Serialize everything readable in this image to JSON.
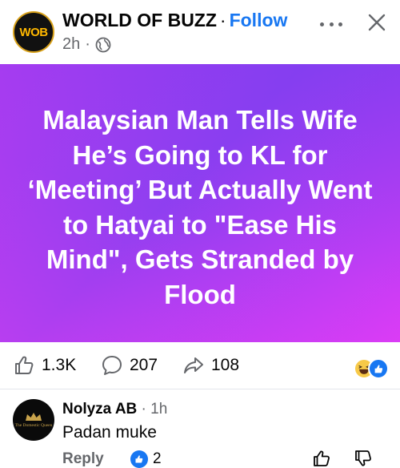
{
  "post": {
    "page_name": "WORLD OF BUZZ",
    "separator": "·",
    "follow_label": "Follow",
    "timestamp": "2h",
    "meta_separator": "·",
    "avatar_logo": {
      "w": "W",
      "ob": "OB"
    },
    "globe_icon": "globe-icon",
    "more_icon": "more-options-icon",
    "close_icon": "close-icon"
  },
  "banner": {
    "headline": "Malaysian Man Tells Wife He’s Going to KL for ‘Meeting’ But Actually Went to Hatyai to \"Ease His Mind\", Gets Stranded by Flood",
    "colors": {
      "start": "#b13cf0",
      "mid": "#8f3ff0",
      "end": "#d83cf6"
    }
  },
  "stats": {
    "likes": "1.3K",
    "comments": "207",
    "shares": "108",
    "reaction_icons": [
      "haha-emoji-icon",
      "like-reaction-icon"
    ]
  },
  "comment": {
    "author": "Nolyza AB",
    "separator": "·",
    "time": "1h",
    "text": "Padan muke",
    "reply_label": "Reply",
    "like_count": "2",
    "avatar_text": "The Domestic Queen"
  },
  "colors": {
    "accent": "#1877f2",
    "secondary_text": "#65676b",
    "primary_text": "#050505"
  }
}
